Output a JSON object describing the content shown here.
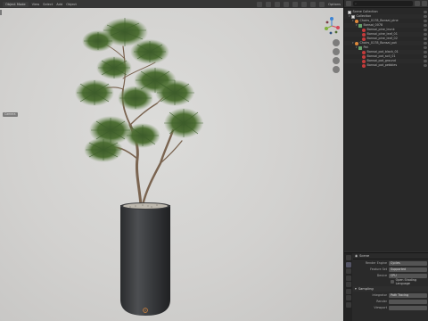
{
  "viewport": {
    "mode": "Object Mode",
    "menus": [
      "View",
      "Select",
      "Add",
      "Object"
    ],
    "camera_badge": "Camera",
    "header_right": "Options"
  },
  "outliner": {
    "search_placeholder": "",
    "items": [
      {
        "label": "Scene Collection",
        "depth": 0,
        "icon": "collection-icon",
        "toggle": ""
      },
      {
        "label": "Collection",
        "depth": 1,
        "icon": "collection-icon",
        "toggle": "▾"
      },
      {
        "label": "Chairs_0178_Bonsai_pine",
        "depth": 2,
        "icon": "object-icon",
        "toggle": "▾"
      },
      {
        "label": "Bonsai_0078",
        "depth": 3,
        "icon": "mesh-icon",
        "toggle": "▾"
      },
      {
        "label": "Bonsai_pine_trunk",
        "depth": 4,
        "icon": "material-icon",
        "toggle": ""
      },
      {
        "label": "Bonsai_pine_leaf_01",
        "depth": 4,
        "icon": "material-icon",
        "toggle": ""
      },
      {
        "label": "Bonsai_pine_leaf_02",
        "depth": 4,
        "icon": "material-icon",
        "toggle": ""
      },
      {
        "label": "Chairs_0178_Bonsai_pot",
        "depth": 2,
        "icon": "object-icon",
        "toggle": "▾"
      },
      {
        "label": "Pot",
        "depth": 3,
        "icon": "mesh-icon",
        "toggle": "▾"
      },
      {
        "label": "Bonsai_pot_black_01",
        "depth": 4,
        "icon": "material-icon",
        "toggle": ""
      },
      {
        "label": "Bonsai_pot_soil_01",
        "depth": 4,
        "icon": "material-icon",
        "toggle": ""
      },
      {
        "label": "Bonsai_pot_ground",
        "depth": 4,
        "icon": "material-icon",
        "toggle": ""
      },
      {
        "label": "Bonsai_pot_pebbles",
        "depth": 4,
        "icon": "material-icon",
        "toggle": ""
      }
    ]
  },
  "properties": {
    "header_title": "Scene",
    "rows": [
      {
        "label": "Render Engine",
        "value": "Cycles"
      },
      {
        "label": "Feature Set",
        "value": "Supported"
      },
      {
        "label": "Device",
        "value": "CPU"
      }
    ],
    "checkbox_label": "Open Shading Language",
    "section": "Sampling",
    "rows2": [
      {
        "label": "Integrator",
        "value": "Path Tracing"
      },
      {
        "label": "Render",
        "value": ""
      },
      {
        "label": "Viewport",
        "value": ""
      }
    ]
  },
  "colors": {
    "accent": "#e08a3c",
    "material": "#c43b3b",
    "gizmo_x": "#d6485a",
    "gizmo_y": "#7fb03b",
    "gizmo_z": "#3d84d4"
  }
}
